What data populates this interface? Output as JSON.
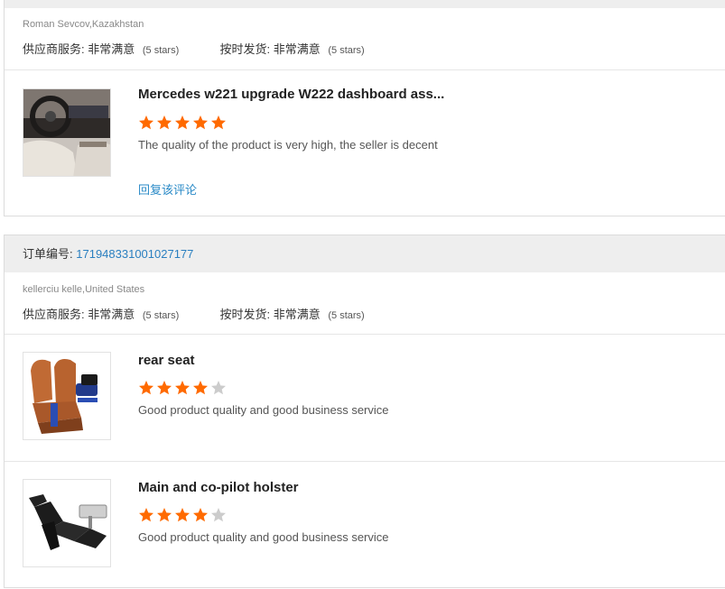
{
  "colors": {
    "accent_link": "#2a8ac7",
    "star_filled": "#ff6a00",
    "star_empty": "#cccccc",
    "header_bg": "#eeeeee"
  },
  "reviews": [
    {
      "buyer": "Roman Sevcov,Kazakhstan",
      "supplier_service_label": "供应商服务:",
      "supplier_service_value": "非常满意",
      "supplier_service_stars": "(5 stars)",
      "ontime_label": "按时发货:",
      "ontime_value": "非常满意",
      "ontime_stars": "(5 stars)",
      "items": [
        {
          "title": "Mercedes w221 upgrade W222 dashboard ass...",
          "rating": 5,
          "text": "The quality of the product is very high, the seller is decent",
          "reply_label": "回复该评论",
          "image_icon": "car-interior-photo"
        }
      ]
    },
    {
      "order_label": "订单编号:",
      "order_number": "171948331001027177",
      "buyer": "kellerciu kelle,United States",
      "supplier_service_label": "供应商服务:",
      "supplier_service_value": "非常满意",
      "supplier_service_stars": "(5 stars)",
      "ontime_label": "按时发货:",
      "ontime_value": "非常满意",
      "ontime_stars": "(5 stars)",
      "items": [
        {
          "title": "rear seat",
          "rating": 4,
          "text": "Good product quality and good business service",
          "image_icon": "leather-seat-photo"
        },
        {
          "title": "Main and co-pilot holster",
          "rating": 4,
          "text": "Good product quality and good business service",
          "image_icon": "reclining-seat-photo"
        }
      ]
    }
  ]
}
